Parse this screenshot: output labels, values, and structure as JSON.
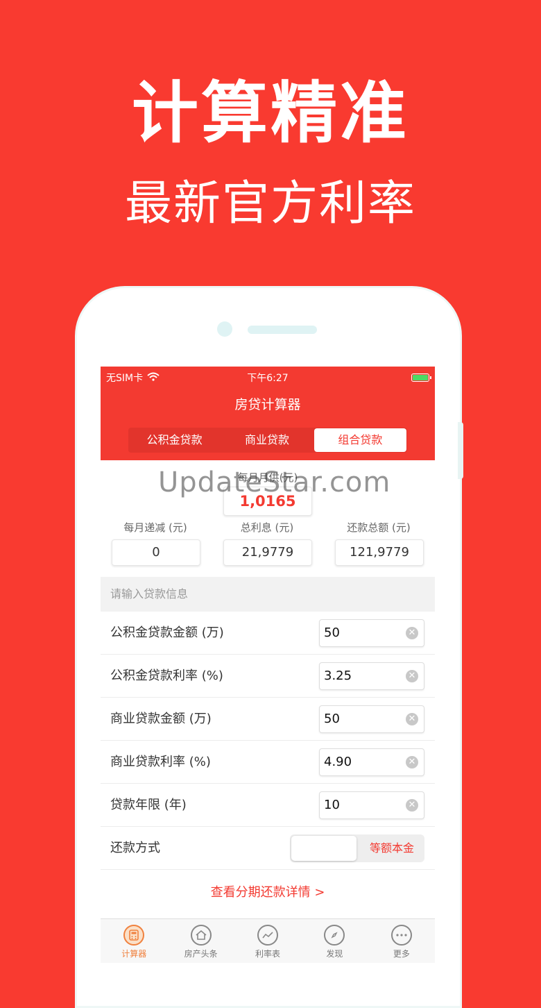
{
  "promo": {
    "headline": "计算精准",
    "subheadline": "最新官方利率"
  },
  "status_bar": {
    "carrier": "无SIM卡",
    "time": "下午6:27"
  },
  "app": {
    "title": "房贷计算器",
    "tabs": [
      {
        "label": "公积金贷款",
        "active": false
      },
      {
        "label": "商业贷款",
        "active": false
      },
      {
        "label": "组合贷款",
        "active": true
      }
    ]
  },
  "results": {
    "monthly_payment_label": "每月月供(元)",
    "monthly_payment": "1,0165",
    "monthly_decrease_label": "每月递减 (元)",
    "monthly_decrease": "0",
    "total_interest_label": "总利息 (元)",
    "total_interest": "21,9779",
    "total_repayment_label": "还款总额 (元)",
    "total_repayment": "121,9779"
  },
  "watermark": "UpdateStar.com",
  "form": {
    "section_title": "请输入贷款信息",
    "rows": [
      {
        "label": "公积金贷款金额 (万)",
        "value": "50"
      },
      {
        "label": "公积金贷款利率 (%)",
        "value": "3.25"
      },
      {
        "label": "商业贷款金额 (万)",
        "value": "50"
      },
      {
        "label": "商业贷款利率 (%)",
        "value": "4.90"
      },
      {
        "label": "贷款年限 (年)",
        "value": "10"
      }
    ],
    "repayment_method_label": "还款方式",
    "repayment_method_option": "等额本金"
  },
  "detail_link": "查看分期还款详情 >",
  "tabbar": [
    {
      "label": "计算器",
      "icon": "calculator-icon",
      "active": true
    },
    {
      "label": "房产头条",
      "icon": "house-icon",
      "active": false
    },
    {
      "label": "利率表",
      "icon": "chart-line-icon",
      "active": false
    },
    {
      "label": "发现",
      "icon": "compass-icon",
      "active": false
    },
    {
      "label": "更多",
      "icon": "more-dots-icon",
      "active": false
    }
  ],
  "colors": {
    "brand_red": "#f33a31",
    "background_red": "#f93a30",
    "tab_active": "#f0813e"
  }
}
